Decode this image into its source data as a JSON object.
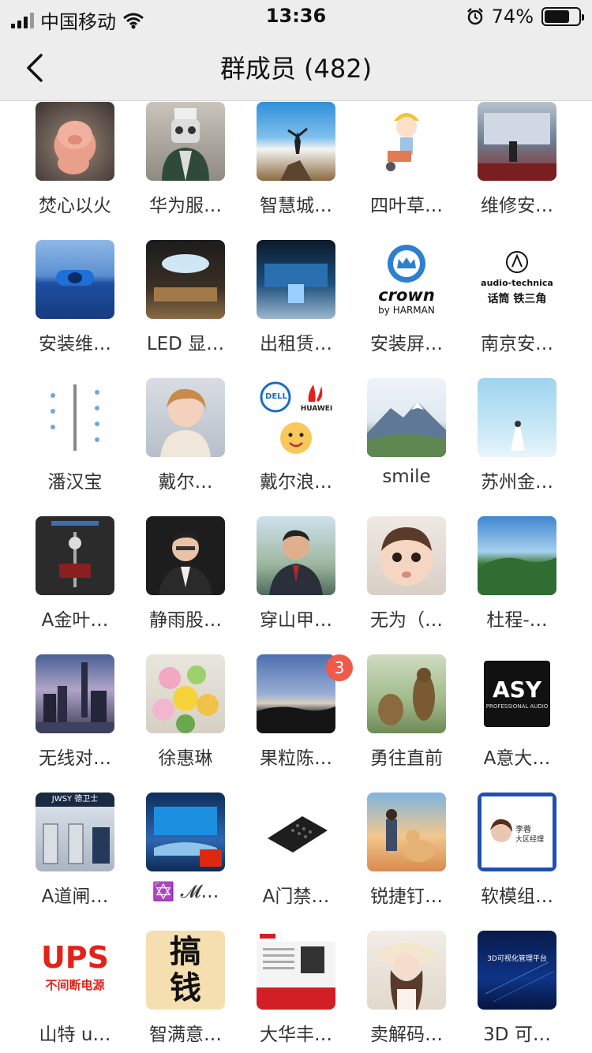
{
  "status": {
    "carrier": "中国移动",
    "time": "13:36",
    "battery": "74%",
    "battery_level": 0.74
  },
  "nav": {
    "title": "群成员 (482)"
  },
  "colors": {
    "bar_bg": "#ededed",
    "badge": "#f05a4a"
  },
  "members": [
    {
      "name": "焚心以火",
      "avatar_icon": "pig-figure"
    },
    {
      "name": "华为服…",
      "avatar_icon": "robot-figure"
    },
    {
      "name": "智慧城…",
      "avatar_icon": "mountain-sky"
    },
    {
      "name": "四叶草…",
      "avatar_icon": "cartoon-worker"
    },
    {
      "name": "维修安…",
      "avatar_icon": "stage-screen"
    },
    {
      "name": "安装维…",
      "avatar_icon": "blue-display"
    },
    {
      "name": "LED 显…",
      "avatar_icon": "dome-screen"
    },
    {
      "name": "出租赁…",
      "avatar_icon": "exhibition-hall"
    },
    {
      "name": "安装屏…",
      "avatar_icon": "crown-logo"
    },
    {
      "name": "南京安…",
      "avatar_icon": "audio-technica-logo"
    },
    {
      "name": "潘汉宝",
      "avatar_icon": "smart-pole-diagram"
    },
    {
      "name": "戴尔…",
      "avatar_icon": "girl-photo"
    },
    {
      "name": "戴尔浪…",
      "avatar_icon": "dell-huawei-logo"
    },
    {
      "name": "smile",
      "avatar_icon": "snow-mountain"
    },
    {
      "name": "苏州金…",
      "avatar_icon": "sky-girl"
    },
    {
      "name": "A金叶…",
      "avatar_icon": "sensor-diagram"
    },
    {
      "name": "静雨股…",
      "avatar_icon": "man-suit"
    },
    {
      "name": "穿山甲…",
      "avatar_icon": "man-lake"
    },
    {
      "name": "无为（…",
      "avatar_icon": "baby-face"
    },
    {
      "name": "杜程-…",
      "avatar_icon": "green-hills"
    },
    {
      "name": "无线对…",
      "avatar_icon": "city-night"
    },
    {
      "name": "徐惠琳",
      "avatar_icon": "flowers"
    },
    {
      "name": "果粒陈…",
      "avatar_icon": "sunset-sky",
      "badge": "3"
    },
    {
      "name": "勇往直前",
      "avatar_icon": "marmots"
    },
    {
      "name": "A意大…",
      "avatar_icon": "asy-logo"
    },
    {
      "name": "A道闸…",
      "avatar_icon": "turnstile-booth"
    },
    {
      "name": "✡️ 𝓜…",
      "avatar_icon": "control-room",
      "flag": true
    },
    {
      "name": "A门禁…",
      "avatar_icon": "access-keypad"
    },
    {
      "name": "锐捷钉…",
      "avatar_icon": "boy-dog-sunset"
    },
    {
      "name": "软模组…",
      "avatar_icon": "business-card"
    },
    {
      "name": "山特 u…",
      "avatar_icon": "ups-logo"
    },
    {
      "name": "智满意…",
      "avatar_icon": "calligraphy"
    },
    {
      "name": "大华丰…",
      "avatar_icon": "dahua-card"
    },
    {
      "name": "卖解码…",
      "avatar_icon": "woman-hat"
    },
    {
      "name": "3D 可…",
      "avatar_icon": "3d-platform"
    }
  ],
  "avatar_text": {
    "crown": "crown",
    "harman": "by HARMAN",
    "at1": "audio-technica",
    "at2": "话筒 铁三角",
    "dell": "DELL",
    "huawei": "HUAWEI",
    "asy": "ASY",
    "asy_sub": "PROFESSIONAL AUDIO",
    "ups": "UPS",
    "ups_sub": "不间断电源",
    "calli": "搞钱",
    "platform": "3D可视化管理平台",
    "jwsy": "JWSY 德卫士",
    "card_role": "大区经理",
    "card_name": "李蓉"
  }
}
